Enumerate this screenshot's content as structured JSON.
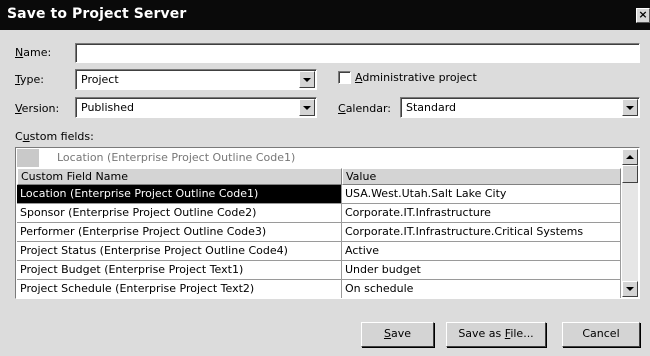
{
  "dialog": {
    "title": "Save to Project Server",
    "close_glyph": "×"
  },
  "fields": {
    "name_label": "Name:",
    "name_value": "",
    "type_label": "Type:",
    "type_value": "Project",
    "administrative_label": "Administrative project",
    "administrative_checked": false,
    "version_label": "Version:",
    "version_value": "Published",
    "calendar_label": "Calendar:",
    "calendar_value": "Standard",
    "custom_fields_label": "Custom fields:"
  },
  "grid": {
    "edit_row_text": "Location (Enterprise Project Outline Code1)",
    "columns": [
      "Custom Field Name",
      "Value"
    ],
    "rows": [
      {
        "name": "Location (Enterprise Project Outline Code1)",
        "value": "USA.West.Utah.Salt Lake City"
      },
      {
        "name": "Sponsor (Enterprise Project Outline Code2)",
        "value": "Corporate.IT.Infrastructure"
      },
      {
        "name": "Performer (Enterprise Project Outline Code3)",
        "value": "Corporate.IT.Infrastructure.Critical Systems"
      },
      {
        "name": "Project Status (Enterprise Project Outline Code4)",
        "value": "Active"
      },
      {
        "name": "Project Budget (Enterprise Project Text1)",
        "value": "Under budget"
      },
      {
        "name": "Project Schedule (Enterprise Project Text2)",
        "value": "On schedule"
      }
    ],
    "selected_row": 0
  },
  "buttons": {
    "save": "Save",
    "save_as_file": "Save as File...",
    "cancel": "Cancel"
  },
  "icons": {
    "close": "close-icon",
    "dropdown": "chevron-down-icon",
    "scroll_up": "arrow-up-icon",
    "scroll_down": "arrow-down-icon"
  }
}
